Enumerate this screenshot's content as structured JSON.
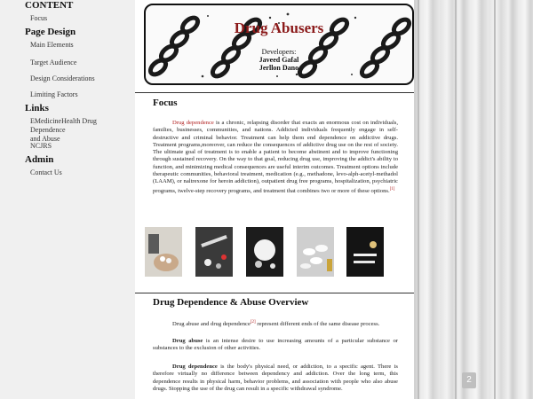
{
  "sidebar": {
    "content_heading": "CONTENT",
    "focus": "Focus",
    "page_design_heading": "Page Design",
    "main_elements": "Main Elements",
    "target_audience": "Target Audience",
    "design_considerations": "Design Considerations",
    "limiting_factors": "Limiting Factors",
    "links_heading": "Links",
    "emedicine_line1": "EMedicineHealth Drug Dependence",
    "emedicine_line2": "and Abuse",
    "ncjrs": "NCJRS",
    "admin_heading": "Admin",
    "contact_us": "Contact Us"
  },
  "banner": {
    "title": "Drug Abusers",
    "developers_label": "Developers:",
    "developer1": "Javeed Gafal",
    "developer2": "Jerllon Dano"
  },
  "focus": {
    "title": "Focus",
    "link_text": "Drug dependence",
    "body": " is a chronic, relapsing disorder that exacts an enormous cost on individuals, families, businesses, communities, and nations. Addicted individuals frequently engage in self- destructive and criminal behavior. Treatment can help them end dependence on addictive drugs. Treatment programs,moreover, can reduce the consequences of addictive drug use on the rest of society. The ultimate goal of treatment is to enable a patient to become abstinent and to improve functioning through sustained recovery. On the way to that goal, reducing drug use, improving the addict's ability to function, and minimizing medical consequences are useful interim outcomes. Treatment options include therapeutic communities, behavioral treatment, medication (e.g., methadone, levo-alph-acetyl-methadol (LAAM), or naltrexone for heroin addiction), outpatient drug free programs, hospitalization, psychiatric programs, twelve-step recovery programs, and treatment that combines two or more of these options.",
    "ref": "[1]"
  },
  "overview": {
    "title": "Drug Dependence & Abuse Overview",
    "p1_text": "Drug abuse and drug dependence",
    "p1_ref": "[2]",
    "p1_rest": " represent different ends of the same disease process.",
    "p2_term": "Drug abuse",
    "p2_text": " is an intense desire to use increasing amounts of a particular substance or substances to the exclusion of other activities.",
    "p3_term": "Drug dependence",
    "p3_text": " is the body's physical need, or addiction, to a specific agent. There is therefore virtually no difference between dependency and addiction. Over the long term, this dependence results in physical harm, behavior problems, and association with people who also abuse drugs. Stopping the use of the drug can result in a specific withdrawal syndrome."
  },
  "thumbnails": [
    "hand-pills",
    "syringe-pills",
    "spilled-pills",
    "white-pills",
    "powder-lines"
  ],
  "corner_badge": "2"
}
